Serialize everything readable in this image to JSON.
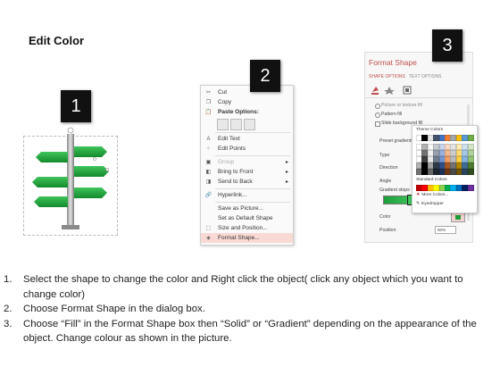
{
  "title": "Edit Color",
  "badges": [
    "1",
    "2",
    "3"
  ],
  "context_menu": {
    "items": [
      {
        "label": "Cut",
        "icon": "scissors-icon",
        "underline": "t"
      },
      {
        "label": "Copy",
        "icon": "copy-icon"
      },
      {
        "label": "Paste Options:",
        "icon": "paste-icon",
        "bold": true
      },
      {
        "label": "Edit Text",
        "icon": "edit-text-icon"
      },
      {
        "label": "Edit Points",
        "icon": "edit-points-icon"
      },
      {
        "label": "Group",
        "icon": "group-icon",
        "disabled": true,
        "submenu": true
      },
      {
        "label": "Bring to Front",
        "icon": "bring-front-icon",
        "submenu": true
      },
      {
        "label": "Send to Back",
        "icon": "send-back-icon",
        "submenu": true
      },
      {
        "label": "Hyperlink...",
        "icon": "hyperlink-icon"
      },
      {
        "label": "Save as Picture...",
        "icon": ""
      },
      {
        "label": "Set as Default Shape",
        "icon": ""
      },
      {
        "label": "Size and Position...",
        "icon": "size-position-icon"
      },
      {
        "label": "Format Shape...",
        "icon": "format-shape-icon",
        "highlighted": true
      }
    ]
  },
  "format_pane": {
    "title": "Format Shape",
    "tabs": [
      "SHAPE OPTIONS",
      "TEXT OPTIONS"
    ],
    "options": [
      "Picture or texture fill",
      "Pattern fill",
      "Slide background fill"
    ],
    "fields": [
      "Preset gradients",
      "Type",
      "Direction",
      "Angle",
      "Gradient stops",
      "Color",
      "Position"
    ],
    "position_value": "50%",
    "color_popup": {
      "theme_label": "Theme Colors",
      "standard_label": "Standard Colors",
      "more_label": "More Colors...",
      "eyedropper_label": "Eyedropper",
      "theme_top": [
        "#ffffff",
        "#000000",
        "#e7e6e6",
        "#44546a",
        "#4472c4",
        "#ed7d31",
        "#a5a5a5",
        "#ffc000",
        "#5b9bd5",
        "#70ad47"
      ],
      "standard": [
        "#c00000",
        "#ff0000",
        "#ffc000",
        "#ffff00",
        "#92d050",
        "#00b050",
        "#00b0f0",
        "#0070c0",
        "#002060",
        "#7030a0"
      ]
    }
  },
  "instructions": [
    {
      "n": "1.",
      "text": "Select the shape to change the color and Right click the object( click any object which you want to change color)"
    },
    {
      "n": "2.",
      "text": "Choose Format Shape in the dialog box."
    },
    {
      "n": "3.",
      "text": "Choose “Fill” in the Format Shape box then “Solid” or “Gradient” depending on the appearance of the object. Change colour as shown in the picture."
    }
  ],
  "colors": {
    "accent": "#c0504d",
    "green_arrow": "#1e9e3a",
    "highlight": "#f9d9d4"
  }
}
